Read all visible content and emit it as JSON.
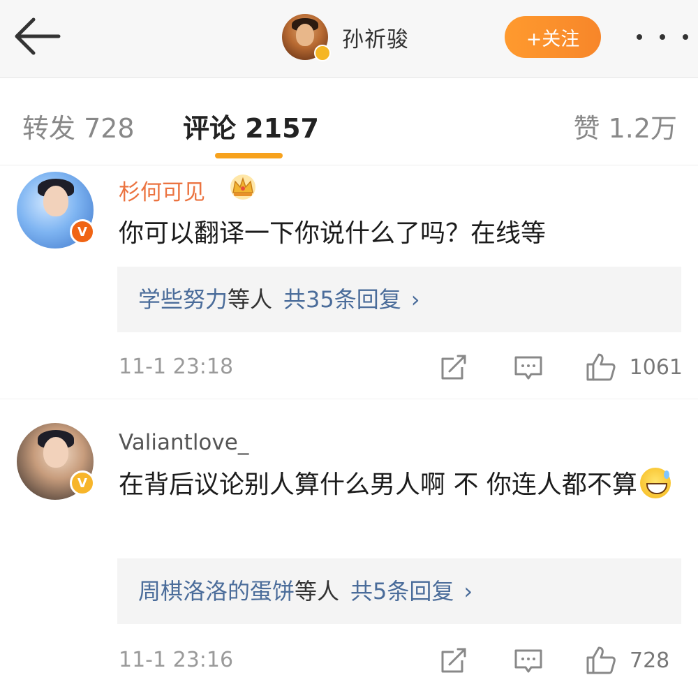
{
  "header": {
    "profile_name": "孙祈骏",
    "follow_label": "+关注",
    "icons": {
      "back": "back-arrow-icon",
      "more": "more-dots-icon",
      "verified": "verified-badge-icon"
    }
  },
  "tabs": {
    "reposts": "转发 728",
    "comments": "评论 2157",
    "likes": "赞 1.2万"
  },
  "colors": {
    "accent": "#f7a21d",
    "follow_button": "#f7862a",
    "member_name": "#eb7340",
    "reply_link": "#4a6c9a"
  },
  "comments": [
    {
      "username": "杉何可见",
      "badge_icon": "crown-icon",
      "text": "你可以翻译一下你说什么了吗？在线等",
      "replies_users": "学些努力",
      "replies_etc": "等人",
      "replies_count": "共35条回复",
      "replies_chevron": "›",
      "timestamp": "11-1 23:18",
      "like_count": "1061"
    },
    {
      "username": "Valiantlove_",
      "text": "在背后议论别人算什么男人啊 不 你连人都不算",
      "emoji": "grinning-sweat-emoji",
      "replies_users": "周棋洛洛的蛋饼",
      "replies_etc": "等人",
      "replies_count": "共5条回复",
      "replies_chevron": "›",
      "timestamp": "11-1 23:16",
      "like_count": "728"
    }
  ]
}
